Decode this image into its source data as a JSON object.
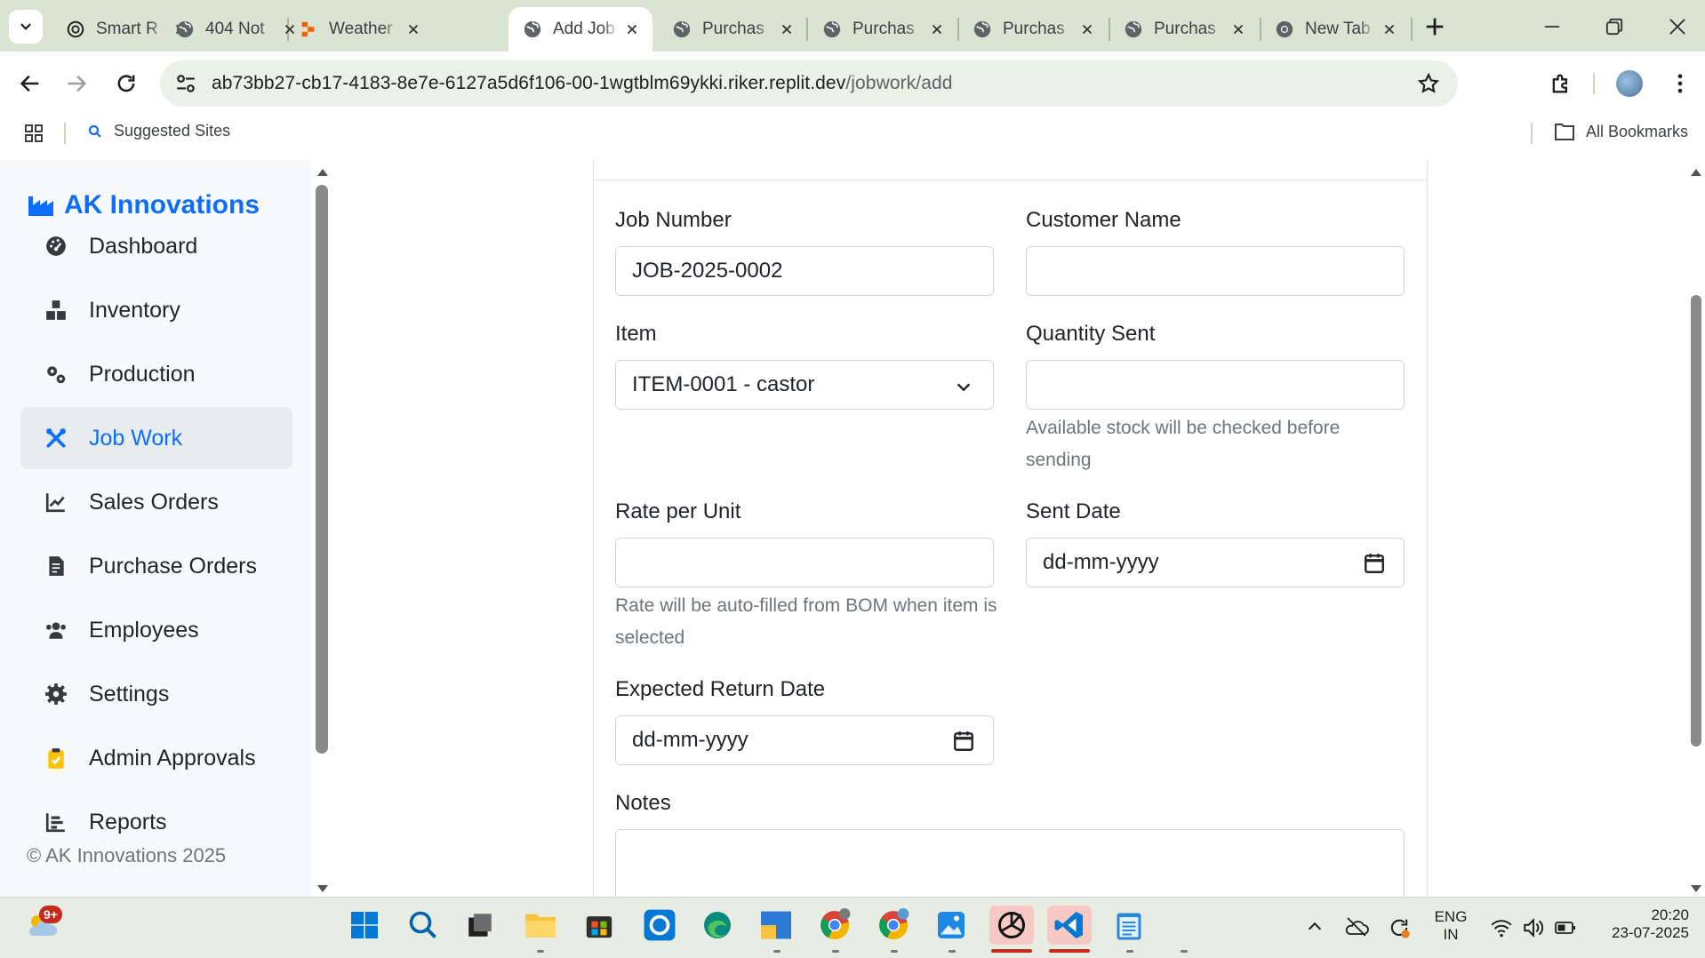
{
  "browser": {
    "tabs": [
      {
        "title": "Smart R",
        "icon": "openai-icon"
      },
      {
        "title": "404 Not",
        "icon": "globe-icon"
      },
      {
        "title": "Weather",
        "icon": "replit-icon"
      },
      {
        "title": "Add Job",
        "icon": "globe-icon",
        "active": true
      },
      {
        "title": "Purchas",
        "icon": "globe-icon"
      },
      {
        "title": "Purchas",
        "icon": "globe-icon"
      },
      {
        "title": "Purchas",
        "icon": "globe-icon"
      },
      {
        "title": "Purchas",
        "icon": "globe-icon"
      },
      {
        "title": "New Tab",
        "icon": "chrome-icon"
      }
    ],
    "url_host": "ab73bb27-cb17-4183-8e7e-6127a5d6f106-00-1wgtblm69ykki.riker.replit.dev",
    "url_path": "/jobwork/add",
    "bookmarks": {
      "suggested": "Suggested Sites",
      "all": "All Bookmarks"
    }
  },
  "app": {
    "brand": "AK Innovations",
    "nav": [
      {
        "label": "Dashboard",
        "icon": "gauge-icon"
      },
      {
        "label": "Inventory",
        "icon": "boxes-icon"
      },
      {
        "label": "Production",
        "icon": "cogs-icon"
      },
      {
        "label": "Job Work",
        "icon": "tools-icon",
        "active": true
      },
      {
        "label": "Sales Orders",
        "icon": "chart-line-icon"
      },
      {
        "label": "Purchase Orders",
        "icon": "file-invoice-icon"
      },
      {
        "label": "Employees",
        "icon": "users-icon"
      },
      {
        "label": "Settings",
        "icon": "gear-icon"
      },
      {
        "label": "Admin Approvals",
        "icon": "clipboard-check-icon"
      },
      {
        "label": "Reports",
        "icon": "chart-bar-icon"
      }
    ],
    "footer": "© AK Innovations 2025",
    "accent_color": "#0d6efd"
  },
  "form": {
    "job_number": {
      "label": "Job Number",
      "value": "JOB-2025-0002"
    },
    "customer_name": {
      "label": "Customer Name",
      "value": ""
    },
    "item": {
      "label": "Item",
      "value": "ITEM-0001 - castor"
    },
    "quantity_sent": {
      "label": "Quantity Sent",
      "value": "",
      "help": "Available stock will be checked before sending"
    },
    "rate_per_unit": {
      "label": "Rate per Unit",
      "value": "",
      "help": "Rate will be auto-filled from BOM when item is selected"
    },
    "sent_date": {
      "label": "Sent Date",
      "placeholder": "dd-mm-yyyy"
    },
    "expected_return_date": {
      "label": "Expected Return Date",
      "placeholder": "dd-mm-yyyy"
    },
    "notes": {
      "label": "Notes",
      "value": ""
    }
  },
  "taskbar": {
    "weather_badge": "9+",
    "lang_line1": "ENG",
    "lang_line2": "IN",
    "time": "20:20",
    "date": "23-07-2025"
  }
}
